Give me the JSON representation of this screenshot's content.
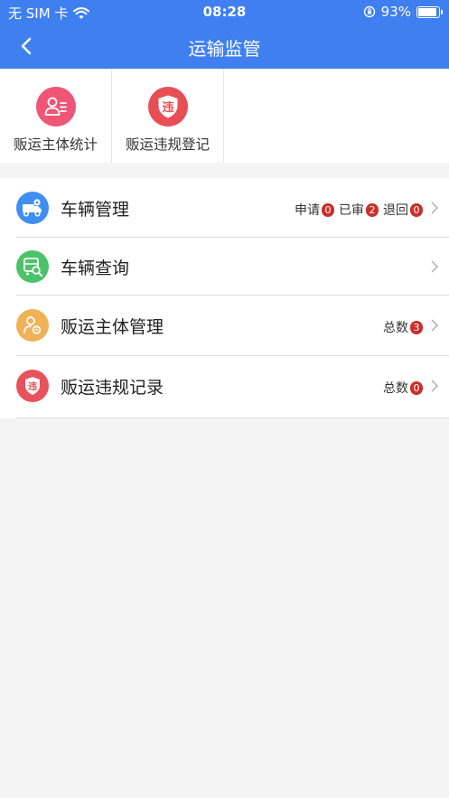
{
  "status_bar": {
    "carrier": "无 SIM 卡",
    "time": "08:28",
    "battery": "93%"
  },
  "header": {
    "title": "运输监管"
  },
  "quick_actions": [
    {
      "label": "贩运主体统计",
      "icon": "user-list-icon",
      "color": "#ee5577"
    },
    {
      "label": "贩运违规登记",
      "icon": "violation-shield-icon",
      "color": "#e84e55"
    }
  ],
  "list": [
    {
      "label": "车辆管理",
      "icon": "truck-gear-icon",
      "color": "#3f8ef2",
      "stats": [
        {
          "label": "申请",
          "count": "0"
        },
        {
          "label": "已审",
          "count": "2"
        },
        {
          "label": "退回",
          "count": "0"
        }
      ]
    },
    {
      "label": "车辆查询",
      "icon": "vehicle-search-icon",
      "color": "#4cc26a",
      "stats": []
    },
    {
      "label": "贩运主体管理",
      "icon": "person-gear-icon",
      "color": "#efb257",
      "stats": [
        {
          "label": "总数",
          "count": "3"
        }
      ]
    },
    {
      "label": "贩运违规记录",
      "icon": "violation-record-icon",
      "color": "#e8525a",
      "stats": [
        {
          "label": "总数",
          "count": "0"
        }
      ]
    }
  ],
  "violation_glyph": "违"
}
